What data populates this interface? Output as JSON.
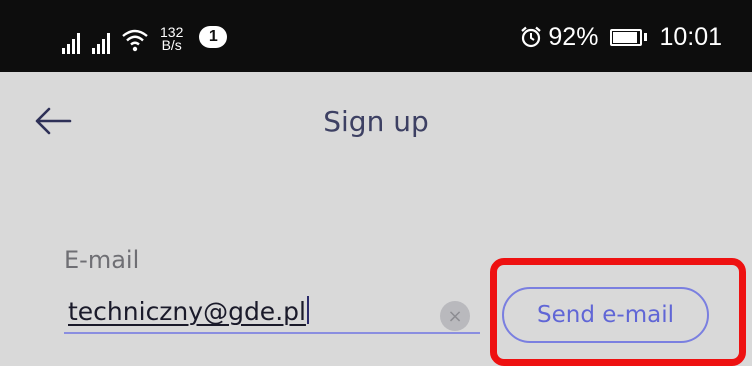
{
  "status_bar": {
    "net_speed_value": "132",
    "net_speed_unit": "B/s",
    "notification_count": "1",
    "battery_percent": "92%",
    "battery_level": 0.92,
    "time": "10:01",
    "icons": [
      "signal-icon",
      "signal-icon",
      "wifi-icon",
      "alarm-icon",
      "battery-icon"
    ]
  },
  "header": {
    "title": "Sign up",
    "back_icon": "arrow-left-icon"
  },
  "form": {
    "email_label": "E-mail",
    "email_value": "techniczny@gde.pl",
    "clear_symbol": "×",
    "send_button_label": "Send e-mail"
  },
  "colors": {
    "background": "#d9d9d9",
    "status_bar": "#0d0d0d",
    "accent": "#6066d6",
    "highlight": "#ee1111"
  }
}
